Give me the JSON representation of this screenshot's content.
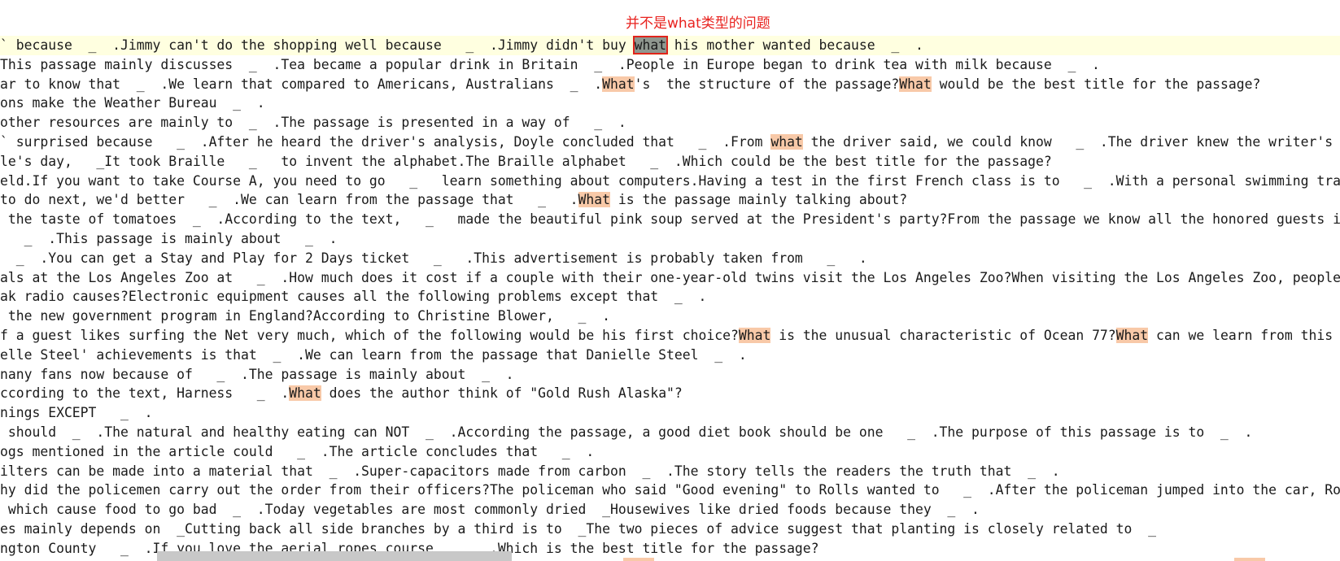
{
  "annotation": "并不是what类型的问题",
  "colors": {
    "annotation": "#e8231f",
    "current_line": "#ffffe0",
    "match_highlight": "#f8c9a8",
    "boxed_selection": "#8f978f",
    "box_border": "#e0241c"
  },
  "lines": [
    [
      "` because  _  .Jimmy can't do the shopping well because   _  .Jimmy didn't buy ",
      {
        "t": "what",
        "h": "boxed"
      },
      " his mother wanted because  _  ."
    ],
    [
      "This passage mainly discusses  _  .Tea became a popular drink in Britain  _  .People in Europe began to drink tea with milk because  _  ."
    ],
    [
      "ar to know that  _  .We learn that compared to Americans, Australians  _  .",
      {
        "t": "What",
        "h": "match"
      },
      "'s  the structure of the passage?",
      {
        "t": "What",
        "h": "match"
      },
      " would be the best title for the passage?"
    ],
    [
      "ons make the Weather Bureau  _  ."
    ],
    [
      "other resources are mainly to  _  .The passage is presented in a way of   _  ."
    ],
    [
      "` surprised because   _  .After he heard the driver's analysis, Doyle concluded that   _  .From ",
      {
        "t": "what",
        "h": "match"
      },
      " the driver said, we could know   _  .The driver knew the writer's name"
    ],
    [
      "le's day,   _It took Braille   _   to invent the alphabet.The Braille alphabet   _  .Which could be the best title for the passage?"
    ],
    [
      "eld.If you want to take Course A, you need to go   _   learn something about computers.Having a test in the first French class is to   _  .With a personal swimming trainer"
    ],
    [
      "to do next, we'd better   _  .We can learn from the passage that   _   .",
      {
        "t": "What",
        "h": "match"
      },
      " is the passage mainly talking about?"
    ],
    [
      " the taste of tomatoes  _  .According to the text,   _   made the beautiful pink soup served at the President's party?From the passage we know all the honored guests invit"
    ],
    [
      "   _  .This passage is mainly about   _  ."
    ],
    [
      "  _  .You can get a Stay and Play for 2 Days ticket   _   .This advertisement is probably taken from   _   ."
    ],
    [
      "als at the Los Angeles Zoo at   _  .How much does it cost if a couple with their one-year-old twins visit the Los Angeles Zoo?When visiting the Los Angeles Zoo, people can"
    ],
    [
      "ak radio causes?Electronic equipment causes all the following problems except that  _  ."
    ],
    [
      " the new government program in England?According to Christine Blower,   _  ."
    ],
    [
      "f a guest likes surfing the Net very much, which of the following would be his first choice?",
      {
        "t": "What",
        "h": "match"
      },
      " is the unusual characteristic of Ocean 77?",
      {
        "t": "What",
        "h": "match"
      },
      " can we learn from this pass"
    ],
    [
      "elle Steel' achievements is that  _  .We can learn from the passage that Danielle Steel  _  ."
    ],
    [
      "nany fans now because of   _  .The passage is mainly about  _  ."
    ],
    [
      "ccording to the text, Harness   _  .",
      {
        "t": "What",
        "h": "match"
      },
      " does the author think of \"Gold Rush Alaska\"?"
    ],
    [
      "nings EXCEPT   _  ."
    ],
    [
      " should  _  .The natural and healthy eating can NOT  _  .According the passage, a good diet book should be one   _  .The purpose of this passage is to  _  ."
    ],
    [
      "ogs mentioned in the article could   _  .The article concludes that   _  ."
    ],
    [
      "ilters can be made into a material that  _  .Super-capacitors made from carbon  _  .The story tells the readers the truth that  _  ."
    ],
    [
      "hy did the policemen carry out the order from their officers?The policeman who said \"Good evening\" to Rolls wanted to   _  .After the policeman jumped into the car, Rolls"
    ],
    [
      " which cause food to go bad  _  .Today vegetables are most commonly dried  _Housewives like dried foods because they  _  ."
    ],
    [
      "es mainly depends on  _Cutting back all side branches by a third is to  _The two pieces of advice suggest that planting is closely related to  _"
    ],
    [
      "ngton County   _  .If you love the aerial ropes course   _   .Which is the best title for the passage?"
    ]
  ]
}
